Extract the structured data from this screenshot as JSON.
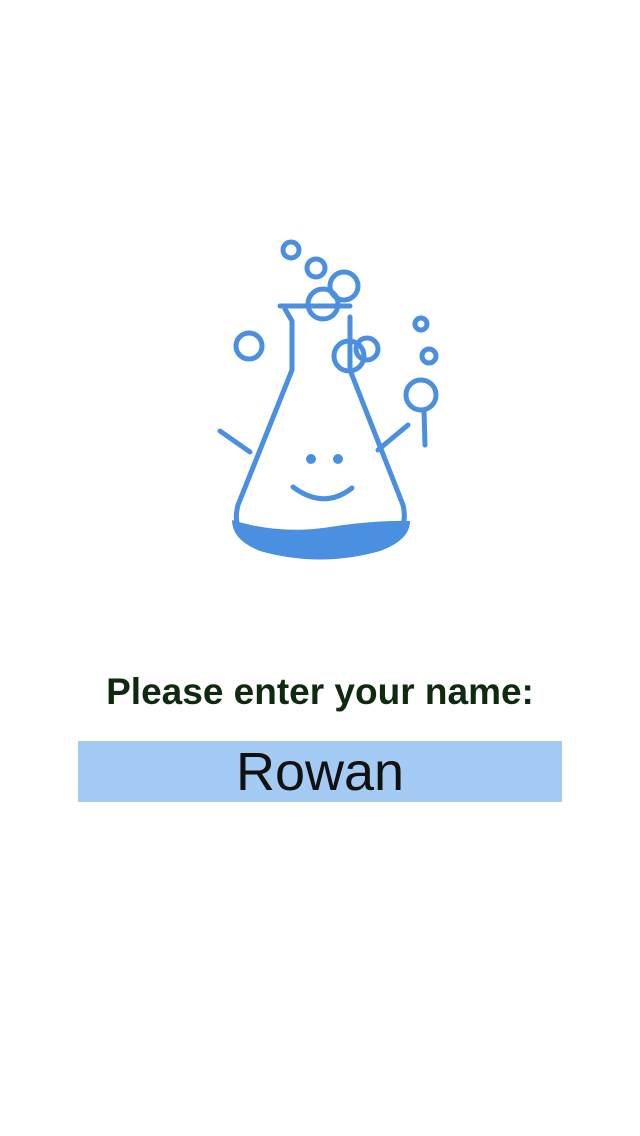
{
  "colors": {
    "accent": "#4a8fe0",
    "field_background": "#a3cbf3",
    "prompt_text": "#0f2a0f",
    "background": "#ffffff"
  },
  "mascot": {
    "icon": "smiling-flask-icon"
  },
  "prompt": {
    "label": "Please enter your name:"
  },
  "name_input": {
    "value": "Rowan",
    "placeholder": ""
  }
}
